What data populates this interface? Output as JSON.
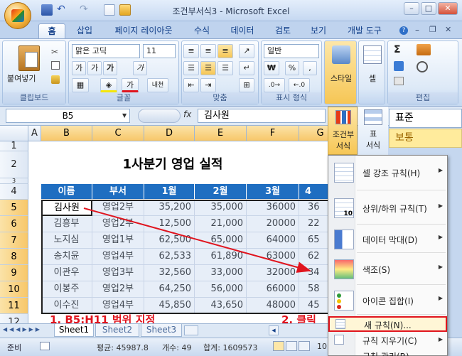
{
  "window": {
    "title": "조건부서식3 - Microsoft Excel",
    "min": "–",
    "max": "□",
    "close": "✕"
  },
  "tabs": [
    "홈",
    "삽입",
    "페이지 레이아웃",
    "수식",
    "데이터",
    "검토",
    "보기",
    "개발 도구"
  ],
  "ribbon": {
    "clipboard": {
      "paste": "붙여넣기",
      "label": "클립보드"
    },
    "font": {
      "name": "맑은 고딕",
      "size": "11",
      "grow": "가",
      "shrink": "가",
      "bold": "가",
      "italic": "가",
      "underline": "가",
      "fontcolor": "가",
      "phonetic": "내천",
      "label": "글꼴"
    },
    "align": {
      "label": "맞춤"
    },
    "number": {
      "format": "일반",
      "currency": "₩",
      "percent": "%",
      "comma": ",",
      "label": "표시 형식"
    },
    "styles": {
      "label": "스타일"
    },
    "cells": {
      "label": "셀"
    },
    "edit": {
      "label": "편집",
      "sum": "Σ"
    },
    "cond": {
      "label_line1": "조건부",
      "label_line2": "서식"
    },
    "table": {
      "label_line1": "표",
      "label_line2": "서식"
    },
    "stylebox": {
      "normal": "표준",
      "good": "보통"
    }
  },
  "formula": {
    "cellref": "B5",
    "fx": "fx",
    "content": "김사원"
  },
  "sheet": {
    "columns": [
      "A",
      "B",
      "C",
      "D",
      "E",
      "F",
      "G"
    ],
    "rows": [
      "1",
      "2",
      "3",
      "4",
      "5",
      "6",
      "7",
      "8",
      "9",
      "10",
      "11",
      "12"
    ],
    "title": "1사분기 영업 실적",
    "headers": [
      "이름",
      "부서",
      "1월",
      "2월",
      "3월",
      "4"
    ],
    "data": [
      [
        "김사원",
        "영업2부",
        "35,200",
        "35,000",
        "36000",
        "36"
      ],
      [
        "김흥부",
        "영업2부",
        "12,500",
        "21,000",
        "20000",
        "22"
      ],
      [
        "노지심",
        "영업1부",
        "62,500",
        "65,000",
        "64000",
        "65"
      ],
      [
        "송치윤",
        "영업4부",
        "62,533",
        "61,890",
        "63000",
        "62"
      ],
      [
        "이관우",
        "영업3부",
        "32,560",
        "33,000",
        "32000",
        "34"
      ],
      [
        "이봉주",
        "영업2부",
        "64,250",
        "56,000",
        "66000",
        "58"
      ],
      [
        "이수진",
        "영업4부",
        "45,850",
        "43,650",
        "48000",
        "45"
      ]
    ],
    "sheet_tabs": [
      "Sheet1",
      "Sheet2",
      "Sheet3"
    ]
  },
  "annotations": {
    "step1": "1. B5:H11 범위 지정",
    "step2": "2. 클릭"
  },
  "status": {
    "mode": "준비",
    "average": "평균: 45987.8",
    "count": "개수: 49",
    "sum": "합계: 1609573",
    "zoom": "10"
  },
  "menu": {
    "items": [
      {
        "label": "셀 강조 규칙(H)",
        "arrow": "▶"
      },
      {
        "label": "상위/하위 규칙(T)",
        "arrow": "▶"
      },
      {
        "label": "데이터 막대(D)",
        "arrow": "▶"
      },
      {
        "label": "색조(S)",
        "arrow": "▶"
      },
      {
        "label": "아이콘 집합(I)",
        "arrow": "▶"
      }
    ],
    "new_rule": "새 규칙(N)...",
    "clear_rule": "규칙 지우기(C)",
    "manage_rule": "규칙 관리(R)..."
  },
  "colors": {
    "accent": "#1f6ec1",
    "highlight": "#e0141e",
    "ribbon": "#d7e5f6"
  }
}
